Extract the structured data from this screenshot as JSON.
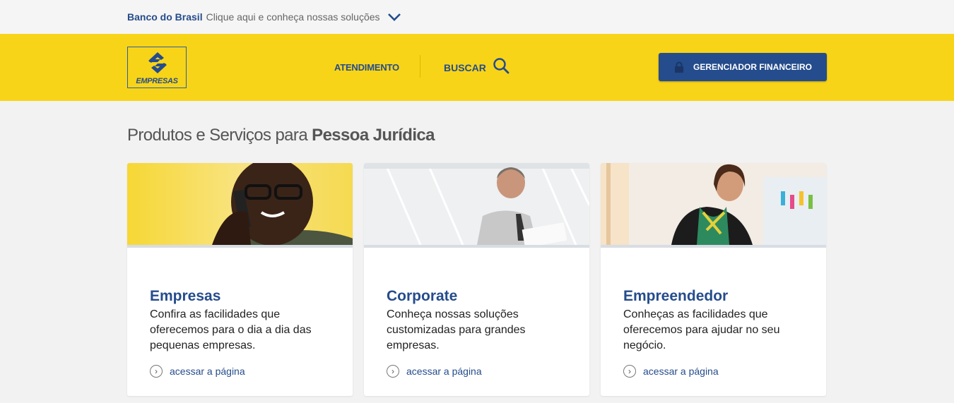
{
  "topbar": {
    "brand": "Banco do Brasil",
    "text": "Clique aqui e conheça nossas soluções",
    "icon": "chevron-down-icon"
  },
  "header": {
    "logo_text": "EMPRESAS",
    "nav": {
      "atendimento": "ATENDIMENTO",
      "buscar": "BUSCAR"
    },
    "cta": {
      "label": "GERENCIADOR FINANCEIRO",
      "icon": "lock-icon"
    }
  },
  "main": {
    "title_prefix": "Produtos e Serviços para ",
    "title_strong": "Pessoa Jurídica",
    "cards": [
      {
        "title": "Empresas",
        "description": "Confira as facilidades que oferecemos para o dia a dia das pequenas empresas.",
        "link": "acessar a página"
      },
      {
        "title": "Corporate",
        "description": "Conheça nossas soluções customizadas para grandes empresas.",
        "link": "acessar a página"
      },
      {
        "title": "Empreendedor",
        "description": "Conheças as facilidades que oferecemos para ajudar no seu negócio.",
        "link": "acessar a página"
      }
    ]
  },
  "colors": {
    "brand_blue": "#254c8c",
    "brand_yellow": "#f8d418",
    "background": "#f2f2f2"
  }
}
